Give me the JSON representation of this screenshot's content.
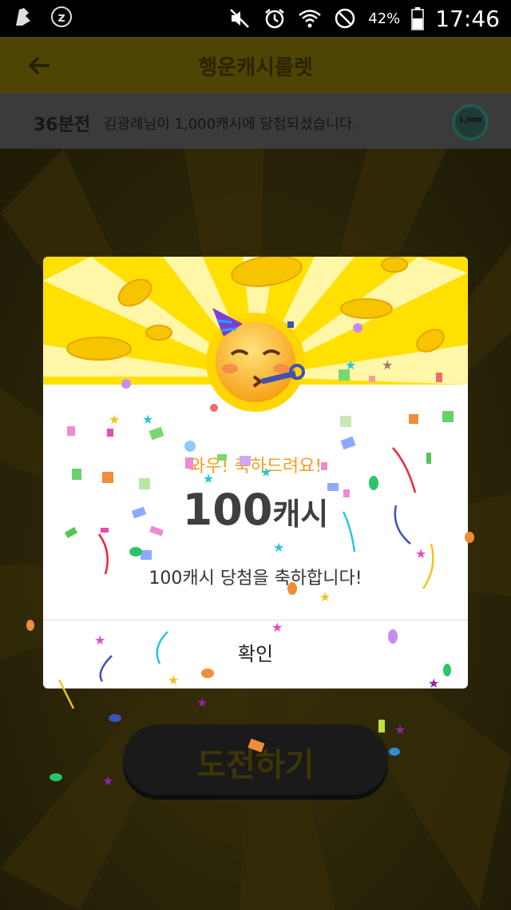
{
  "status_bar": {
    "battery_pct": "42%",
    "clock": "17:46",
    "icons": [
      "app-notification-icon",
      "z-icon",
      "mute-icon",
      "alarm-icon",
      "wifi-icon",
      "blocked-icon",
      "battery-icon"
    ]
  },
  "header": {
    "title": "행운캐시룰렛",
    "back_icon": "back-arrow-icon"
  },
  "ticker": {
    "time": "36분전",
    "text": "김광례님이 1,000캐시에 당첨되셨습니다.",
    "chip_label": "1,000"
  },
  "dialog": {
    "congrats": "와우! 축하드려요!",
    "amount_number": "100",
    "amount_unit": "캐시",
    "message": "100캐시 당첨을 축하합니다!",
    "confirm_label": "확인",
    "emoji": "party-face-emoji"
  },
  "main": {
    "start_button_label": "도전하기"
  },
  "colors": {
    "yellow": "#ffe000",
    "orange_text": "#f0a020",
    "status_bar": "#000000"
  }
}
